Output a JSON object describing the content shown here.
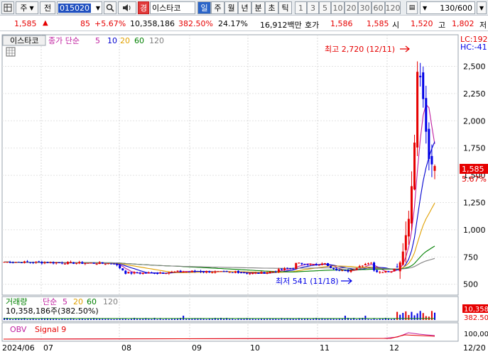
{
  "toolbar": {
    "market": "주",
    "period": "전",
    "code": "015020",
    "grade_badge": "경",
    "name": "이스타코",
    "periods": [
      "일",
      "주",
      "월",
      "년",
      "분",
      "초",
      "틱"
    ],
    "numbers": [
      "1",
      "3",
      "5",
      "10",
      "20",
      "30",
      "60",
      "120"
    ],
    "page_counter": "130/600",
    "search_icon": "search-icon",
    "sound_icon": "speaker-icon"
  },
  "quote": {
    "price": "1,585",
    "direction_icon": "up-triangle-icon",
    "change": "85",
    "change_pct": "+5.67%",
    "volume": "10,358,186",
    "volume_ratio": "382.50%",
    "turnover": "24.17%",
    "amount": "16,912백만",
    "ask_label": "호가",
    "ask1": "1,586",
    "ask2": "1,585",
    "open_label": "시",
    "open": "1,520",
    "high_label": "고",
    "high": "1,802",
    "low_label": "저",
    "up_color": "#e60000",
    "down_color": "#0000e6"
  },
  "panel": {
    "stock_tab": "이스타코",
    "legend_prefix": "종가 단순",
    "ma_periods": [
      "5",
      "10",
      "20",
      "60",
      "120"
    ],
    "ma_colors": [
      "#c020a0",
      "#0000d0",
      "#e0a000",
      "#008000",
      "#808080"
    ],
    "lc": "LC:192",
    "hc": "HC:-41",
    "high_note": "최고 2,720 (12/11)",
    "low_note": "최저 541 (11/18)",
    "last_price": "1,585",
    "last_pct": "5.67%"
  },
  "volume_panel": {
    "title": "거래량",
    "legend_prefix": "단순",
    "ma_periods": [
      "5",
      "20",
      "60",
      "120"
    ],
    "value": "10,358,186주(382.50%)",
    "scale_top": "10,358",
    "scale_bottom": "382.50"
  },
  "obv_panel": {
    "title": "OBV",
    "signal": "Signal 9",
    "scale": "100,00"
  },
  "chart_data": {
    "type": "candlestick",
    "title": "",
    "y_ticks": [
      500,
      750,
      1000,
      1250,
      1500,
      1750,
      2000,
      2250,
      2500
    ],
    "ylim": [
      400,
      2790
    ],
    "x_labels": [
      "2024/06",
      "07",
      "08",
      "09",
      "10",
      "11",
      "12",
      "12/20"
    ],
    "candles_sample": [
      {
        "period": "Jun",
        "o": 720,
        "h": 735,
        "l": 690,
        "c": 700
      },
      {
        "period": "Jul",
        "o": 700,
        "h": 720,
        "l": 680,
        "c": 695
      },
      {
        "period": "Aug",
        "o": 650,
        "h": 690,
        "l": 590,
        "c": 620
      },
      {
        "period": "Sep",
        "o": 600,
        "h": 630,
        "l": 590,
        "c": 605
      },
      {
        "period": "Oct",
        "o": 620,
        "h": 780,
        "l": 600,
        "c": 660
      },
      {
        "period": "Nov",
        "o": 700,
        "h": 720,
        "l": 541,
        "c": 600
      },
      {
        "period": "Dec-early",
        "o": 650,
        "h": 1100,
        "l": 630,
        "c": 1050
      },
      {
        "period": "Dec-10",
        "o": 1800,
        "h": 2500,
        "l": 1700,
        "c": 2450
      },
      {
        "period": "Dec-11",
        "o": 2450,
        "h": 2720,
        "l": 2300,
        "c": 2400
      },
      {
        "period": "Dec-20",
        "o": 1520,
        "h": 1802,
        "l": 1480,
        "c": 1585
      }
    ],
    "high": 2720,
    "low": 541,
    "last": 1585
  }
}
